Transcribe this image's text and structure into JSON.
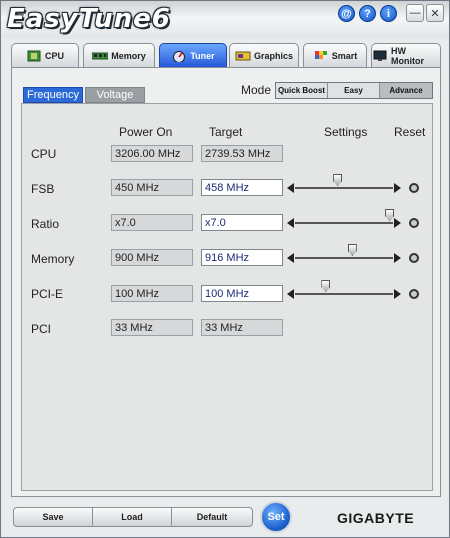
{
  "window": {
    "title": "EasyTune6"
  },
  "title_buttons": [
    "@",
    "?",
    "i"
  ],
  "tabs": [
    {
      "label": "CPU",
      "icon": "cpu-chip-icon"
    },
    {
      "label": "Memory",
      "icon": "memory-module-icon"
    },
    {
      "label": "Tuner",
      "icon": "speedometer-icon",
      "active": true
    },
    {
      "label": "Graphics",
      "icon": "graphics-card-icon"
    },
    {
      "label": "Smart",
      "icon": "smart-cube-icon"
    },
    {
      "label": "HW Monitor",
      "icon": "monitor-icon"
    }
  ],
  "subtabs": [
    {
      "label": "Frequency",
      "active": true
    },
    {
      "label": "Voltage",
      "active": false
    }
  ],
  "mode": {
    "label": "Mode",
    "options": [
      "Quick Boost",
      "Easy",
      "Advance"
    ],
    "selected": "Advance"
  },
  "columns": {
    "power_on": "Power On",
    "target": "Target",
    "settings": "Settings",
    "reset": "Reset"
  },
  "rows": [
    {
      "name": "CPU",
      "power_on": "3206.00 MHz",
      "target": "2739.53 MHz",
      "editable": false
    },
    {
      "name": "FSB",
      "power_on": "450 MHz",
      "target": "458 MHz",
      "editable": true,
      "slider": 0.43
    },
    {
      "name": "Ratio",
      "power_on": "x7.0",
      "target": "x7.0",
      "editable": true,
      "slider": 0.96
    },
    {
      "name": "Memory",
      "power_on": "900 MHz",
      "target": "916 MHz",
      "editable": true,
      "slider": 0.58
    },
    {
      "name": "PCI-E",
      "power_on": "100 MHz",
      "target": "100 MHz",
      "editable": true,
      "slider": 0.31
    },
    {
      "name": "PCI",
      "power_on": "33 MHz",
      "target": "33 MHz",
      "editable": false
    }
  ],
  "bottom": {
    "save": "Save",
    "load": "Load",
    "default": "Default",
    "set": "Set"
  },
  "brand": "GIGABYTE",
  "colors": {
    "accent": "#2c6ad8",
    "tab_active": "#2558d8",
    "target_text": "#1c2a78"
  }
}
